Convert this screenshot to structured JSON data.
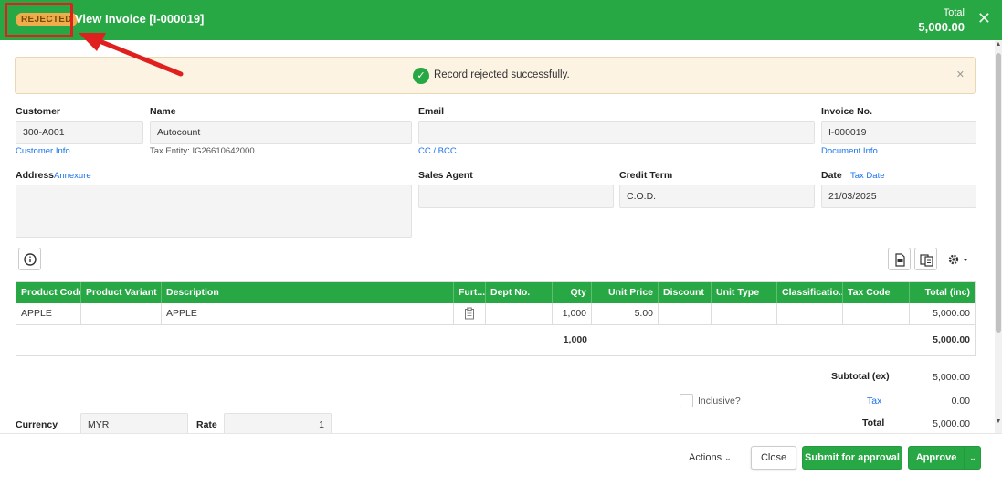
{
  "header": {
    "status_badge": "REJECTED",
    "title": "View Invoice [I-000019]",
    "total_label": "Total",
    "total_value": "5,000.00"
  },
  "alert": {
    "message": "Record rejected successfully."
  },
  "form": {
    "customer_label": "Customer",
    "customer_value": "300-A001",
    "customer_info_link": "Customer Info",
    "name_label": "Name",
    "name_value": "Autocount",
    "tax_entity": "Tax Entity: IG26610642000",
    "email_label": "Email",
    "email_value": "",
    "cc_bcc_link": "CC / BCC",
    "invoice_no_label": "Invoice No.",
    "invoice_no_value": "I-000019",
    "document_info_link": "Document Info",
    "address_label": "Address",
    "annexure_link": "Annexure",
    "address_value": "",
    "sales_agent_label": "Sales Agent",
    "sales_agent_value": "",
    "credit_term_label": "Credit Term",
    "credit_term_value": "C.O.D.",
    "date_label": "Date",
    "tax_date_link": "Tax Date",
    "date_value": "21/03/2025"
  },
  "grid": {
    "columns": [
      "Product Code",
      "Product Variant",
      "Description",
      "Furt...",
      "Dept No.",
      "Qty",
      "Unit Price",
      "Discount",
      "Unit Type",
      "Classificatio...",
      "Tax Code",
      "Total (inc)"
    ],
    "rows": [
      {
        "product_code": "APPLE",
        "product_variant": "",
        "description": "APPLE",
        "dept_no": "",
        "qty": "1,000",
        "unit_price": "5.00",
        "discount": "",
        "unit_type": "",
        "classification": "",
        "tax_code": "",
        "total": "5,000.00"
      }
    ],
    "sum_qty": "1,000",
    "sum_total": "5,000.00"
  },
  "summary": {
    "subtotal_label": "Subtotal (ex)",
    "subtotal_value": "5,000.00",
    "inclusive_label": "Inclusive?",
    "inclusive_checked": false,
    "tax_label": "Tax",
    "tax_value": "0.00",
    "total_label": "Total",
    "total_value": "5,000.00"
  },
  "currency": {
    "label": "Currency",
    "value": "MYR",
    "rate_label": "Rate",
    "rate_value": "1"
  },
  "footer": {
    "actions_label": "Actions",
    "close_label": "Close",
    "submit_label": "Submit for approval",
    "approve_label": "Approve"
  },
  "colors": {
    "primary_green": "#28a745",
    "badge_orange": "#f0ad4e",
    "link_blue": "#1a73e8",
    "highlight_red": "#e0201e"
  }
}
